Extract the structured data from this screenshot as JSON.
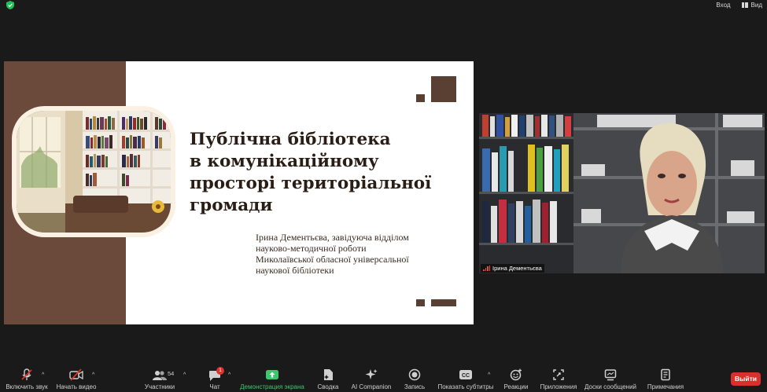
{
  "topbar": {
    "enter_label": "Вход",
    "view_label": "Вид",
    "security_icon": "shield-icon",
    "accent": "#21c15a"
  },
  "slide": {
    "title_lines": [
      "Публічна бібліотека",
      "в комунікаційному",
      "просторі територіальної",
      "громади"
    ],
    "author_lines": [
      "Ірина Дементьєва, завідуюча відділом",
      "науково-методичної роботи",
      "Миколаївської обласної універсальної",
      "наукової бібліотеки"
    ],
    "colors": {
      "sidebar": "#6b4a3c",
      "title": "#2a1d15",
      "photo_frame": "#fbf1e3"
    }
  },
  "video": {
    "participant_name": "Ірина Дементьєва"
  },
  "toolbar": {
    "mute_label": "Включить звук",
    "video_label": "Начать видео",
    "participants_label": "Участники",
    "participants_count": "54",
    "chat_label": "Чат",
    "chat_badge": "1",
    "share_label": "Демонстрация экрана",
    "summary_label": "Сводка",
    "ai_label": "AI Companion",
    "record_label": "Запись",
    "captions_label": "Показать субтитры",
    "reactions_label": "Реакции",
    "apps_label": "Приложения",
    "whiteboards_label": "Доски сообщений",
    "notes_label": "Примечания",
    "leave_label": "Выйти",
    "colors": {
      "leave": "#d9302c",
      "share": "#3fc56b",
      "alert": "#e0312b"
    }
  }
}
